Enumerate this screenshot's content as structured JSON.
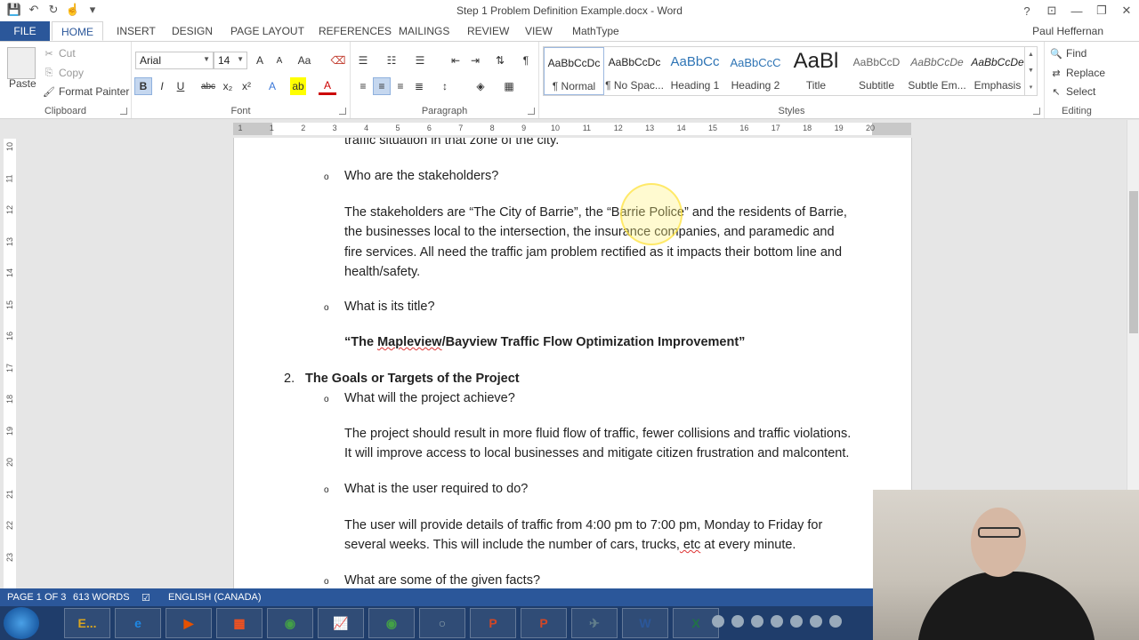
{
  "window": {
    "title": "Step 1 Problem Definition Example.docx - Word",
    "help": "?",
    "ribbon_display": "⊡",
    "minimize": "—",
    "restore": "❐",
    "close": "✕"
  },
  "qat": {
    "save": "💾",
    "undo": "↶",
    "redo": "↻",
    "touch": "☝",
    "customize": "▾"
  },
  "tabs": [
    "FILE",
    "HOME",
    "INSERT",
    "DESIGN",
    "PAGE LAYOUT",
    "REFERENCES",
    "MAILINGS",
    "REVIEW",
    "VIEW",
    "MathType"
  ],
  "active_tab": "HOME",
  "user": "Paul Heffernan",
  "clipboard": {
    "label": "Clipboard",
    "paste": "Paste",
    "cut": "Cut",
    "copy": "Copy",
    "format_painter": "Format Painter"
  },
  "font": {
    "label": "Font",
    "name": "Arial",
    "size": "14",
    "grow": "A",
    "shrink": "A",
    "change_case": "Aa",
    "bold": "B",
    "italic": "I",
    "underline": "U",
    "strike": "abc",
    "subscript": "x₂",
    "superscript": "x²",
    "text_effects": "A",
    "highlight": "ab",
    "font_color": "A"
  },
  "paragraph": {
    "label": "Paragraph"
  },
  "styles": {
    "label": "Styles",
    "items": [
      {
        "preview": "AaBbCcDc",
        "name": "¶ Normal"
      },
      {
        "preview": "AaBbCcDc",
        "name": "¶ No Spac..."
      },
      {
        "preview": "AaBbCc",
        "name": "Heading 1"
      },
      {
        "preview": "AaBbCcC",
        "name": "Heading 2"
      },
      {
        "preview": "AaBl",
        "name": "Title"
      },
      {
        "preview": "AaBbCcD",
        "name": "Subtitle"
      },
      {
        "preview": "AaBbCcDe",
        "name": "Subtle Em..."
      },
      {
        "preview": "AaBbCcDe",
        "name": "Emphasis"
      }
    ]
  },
  "editing": {
    "label": "Editing",
    "find": "Find",
    "replace": "Replace",
    "select": "Select"
  },
  "ruler": {
    "numbers": [
      "1",
      "1",
      "2",
      "3",
      "4",
      "5",
      "6",
      "7",
      "8",
      "9",
      "10",
      "11",
      "12",
      "13",
      "14",
      "15",
      "16",
      "17",
      "18",
      "19",
      "20"
    ]
  },
  "vruler": {
    "numbers": [
      "10",
      "11",
      "12",
      "13",
      "14",
      "15",
      "16",
      "17",
      "18",
      "19",
      "20",
      "21",
      "22",
      "23"
    ]
  },
  "document": {
    "lines": [
      "traffic situation in that zone of the city.",
      "Who are the stakeholders?",
      "The stakeholders are “The City of Barrie”, the “Barrie Police” and the residents of Barrie,",
      "the businesses local to the intersection, the insurance companies, and paramedic and",
      "fire services.  All need the traffic jam problem rectified as it impacts their bottom line and",
      "health/safety.",
      "What is its title?",
      "“The Mapleview/Bayview Traffic Flow Optimization Improvement”",
      "2.",
      "The Goals or Targets of the Project",
      "What will the project achieve?",
      "The project should result in more fluid flow of traffic, fewer collisions and traffic violations.",
      "It will improve access to local businesses and mitigate citizen frustration and malcontent.",
      "What is the user required to do?",
      "The user will provide details of traffic from 4:00 pm to 7:00 pm, Monday to Friday for",
      "several weeks.  This will include the number of cars, trucks, etc at every minute.",
      "What are some of the given facts?"
    ],
    "bullet": "o"
  },
  "status": {
    "page": "PAGE 1 OF 3",
    "words": "613 WORDS",
    "language": "ENGLISH (CANADA)"
  },
  "taskbar": {
    "apps": [
      {
        "name": "explorer",
        "label": "E..."
      },
      {
        "name": "ie",
        "label": "e"
      },
      {
        "name": "media",
        "label": "▶"
      },
      {
        "name": "apps",
        "label": "▦"
      },
      {
        "name": "chrome",
        "label": "◉"
      },
      {
        "name": "chart",
        "label": "📈"
      },
      {
        "name": "chrome2",
        "label": "◉"
      },
      {
        "name": "circle",
        "label": "○"
      },
      {
        "name": "powerpoint",
        "label": "P"
      },
      {
        "name": "powerpoint2",
        "label": "P"
      },
      {
        "name": "bird",
        "label": "✈"
      },
      {
        "name": "word",
        "label": "W"
      },
      {
        "name": "excel",
        "label": "X"
      }
    ]
  },
  "colors": {
    "accent": "#2b579a",
    "taskbar": "#1f3d6b",
    "spell_error": "#d33"
  }
}
